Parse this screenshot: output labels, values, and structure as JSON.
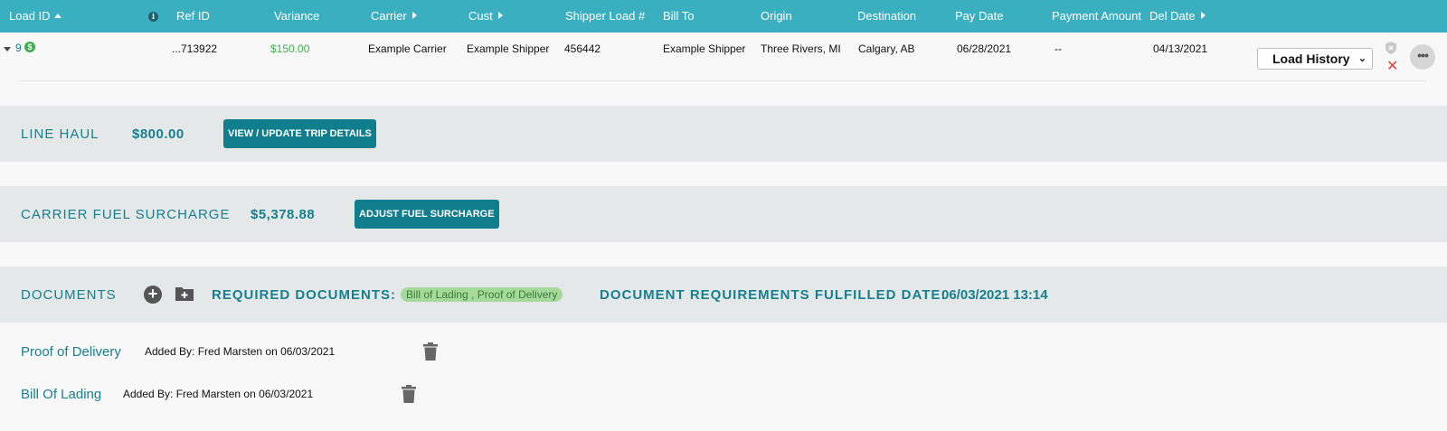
{
  "header": {
    "columns": [
      {
        "label": "Load ID"
      },
      {
        "label": "Ref ID"
      },
      {
        "label": "Variance"
      },
      {
        "label": "Carrier"
      },
      {
        "label": "Cust"
      },
      {
        "label": "Shipper Load #"
      },
      {
        "label": "Bill To"
      },
      {
        "label": "Origin"
      },
      {
        "label": "Destination"
      },
      {
        "label": "Pay Date"
      },
      {
        "label": "Payment Amount"
      },
      {
        "label": "Del Date"
      }
    ],
    "info_icon": "info-icon"
  },
  "row": {
    "load_id": "9",
    "ref_id": "...713922",
    "variance": "$150.00",
    "carrier": "Example Carrier",
    "cust": "Example Shipper",
    "shipper_load": "456442",
    "bill_to": "Example Shipper",
    "origin": "Three Rivers, MI",
    "destination": "Calgary, AB",
    "pay_date": "06/28/2021",
    "payment_amount": "--",
    "del_date": "04/13/2021",
    "history_select": "Load History",
    "more_label": "•••",
    "variance_color": "#3fae4f",
    "icons": {
      "expand": "caret-down-icon",
      "dollar": "dollar-icon",
      "shield": "shield-icon",
      "close": "close-icon",
      "more": "more-icon"
    }
  },
  "line_haul": {
    "label": "LINE HAUL",
    "value": "$800.00",
    "button": "VIEW / UPDATE TRIP DETAILS"
  },
  "fuel": {
    "label": "CARRIER FUEL SURCHARGE",
    "value": "$5,378.88",
    "button": "ADJUST FUEL SURCHARGE"
  },
  "documents": {
    "label": "DOCUMENTS",
    "required_label": "REQUIRED DOCUMENTS:",
    "required_value": "Bill of Lading , Proof of Delivery",
    "fulfilled_label": "DOCUMENT REQUIREMENTS FULFILLED DATE:",
    "fulfilled_value": "06/03/2021 13:14",
    "items": [
      {
        "name": "Proof of Delivery",
        "added": "Added By: Fred Marsten on 06/03/2021"
      },
      {
        "name": "Bill Of Lading",
        "added": "Added By: Fred Marsten on 06/03/2021"
      }
    ]
  },
  "colors": {
    "header_bg": "#3aafc0",
    "accent": "#17808f",
    "button_bg": "#117e8d",
    "band_bg": "#e4e8e8",
    "pill_bg": "#a6d99c"
  }
}
